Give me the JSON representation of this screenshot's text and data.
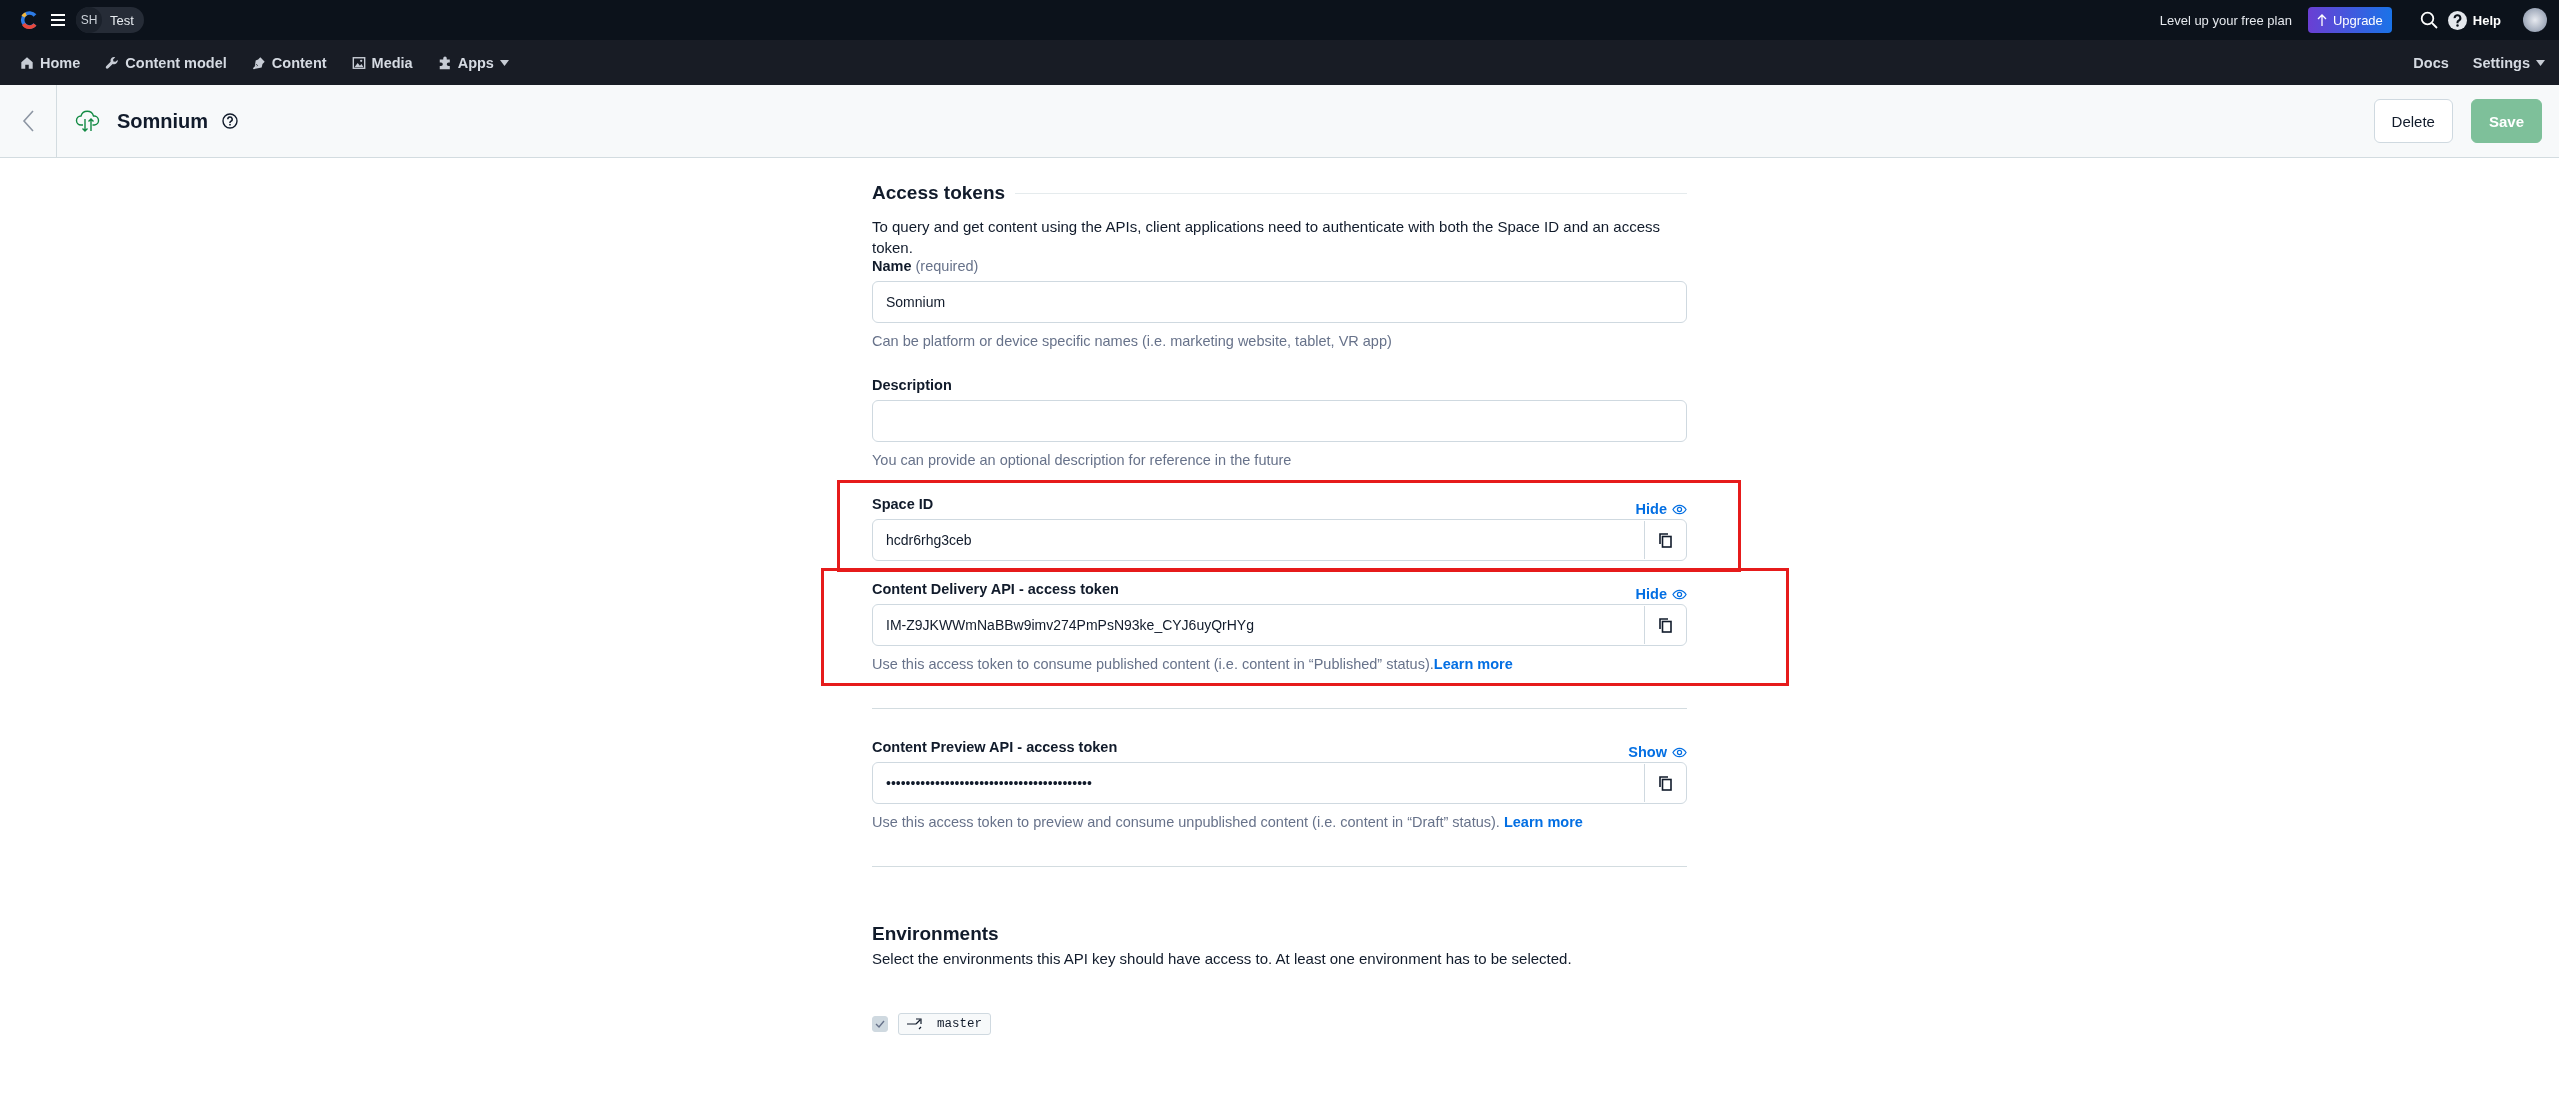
{
  "top_bar": {
    "workspace_initials": "SH",
    "workspace_name": "Test",
    "promo": "Level up your free plan",
    "upgrade_button": "Upgrade",
    "help": "Help"
  },
  "nav": {
    "items": [
      {
        "label": "Home",
        "dropdown": false
      },
      {
        "label": "Content model",
        "dropdown": false
      },
      {
        "label": "Content",
        "dropdown": false
      },
      {
        "label": "Media",
        "dropdown": false
      },
      {
        "label": "Apps",
        "dropdown": true
      }
    ],
    "right_items": [
      {
        "label": "Docs",
        "dropdown": false
      },
      {
        "label": "Settings",
        "dropdown": true
      }
    ]
  },
  "header": {
    "title": "Somnium",
    "buttons": [
      {
        "label": "Delete",
        "kind": "secondary",
        "disabled": false
      },
      {
        "label": "Save",
        "kind": "primary",
        "disabled": true
      }
    ]
  },
  "sections": [
    {
      "title": "Access tokens",
      "intro": "To query and get content using the APIs, client applications need to authenticate with both the Space ID and an access token.",
      "fields": [
        {
          "kind": "text",
          "label": "Name",
          "label_note": "(required)",
          "value": "Somnium",
          "hint": "Can be platform or device specific names (i.e. marketing website, tablet, VR app)",
          "highlighted": false
        },
        {
          "kind": "text",
          "label": "Description",
          "hint": "You can provide an optional description for reference in the future",
          "highlighted": false
        },
        {
          "kind": "secret",
          "label": "Space ID",
          "toggle": "Hide",
          "value": "hcdr6rhg3ceb",
          "highlighted": true
        },
        {
          "kind": "secret",
          "label": "Content Delivery API - access token",
          "toggle": "Hide",
          "value": "IM-Z9JKWWmNaBBw9imv274PmPsN93ke_CYJ6uyQrHYg",
          "hint": "Use this access token to consume published content (i.e. content in “Published” status).",
          "hint_link": "Learn more",
          "highlighted": true
        }
      ]
    },
    {
      "fields": [
        {
          "kind": "secret",
          "label": "Content Preview API - access token",
          "toggle": "Show",
          "value": "••••••••••••••••••••••••••••••••••••••••••",
          "hint": "Use this access token to preview and consume unpublished content (i.e. content in “Draft” status). ",
          "hint_link": "Learn more",
          "highlighted": false
        }
      ]
    },
    {
      "title": "Environments",
      "intro": "Select the environments this API key should have access to. At least one environment has to be selected.",
      "environments": [
        {
          "name": "master",
          "checked": true,
          "disabled": true
        }
      ]
    }
  ]
}
